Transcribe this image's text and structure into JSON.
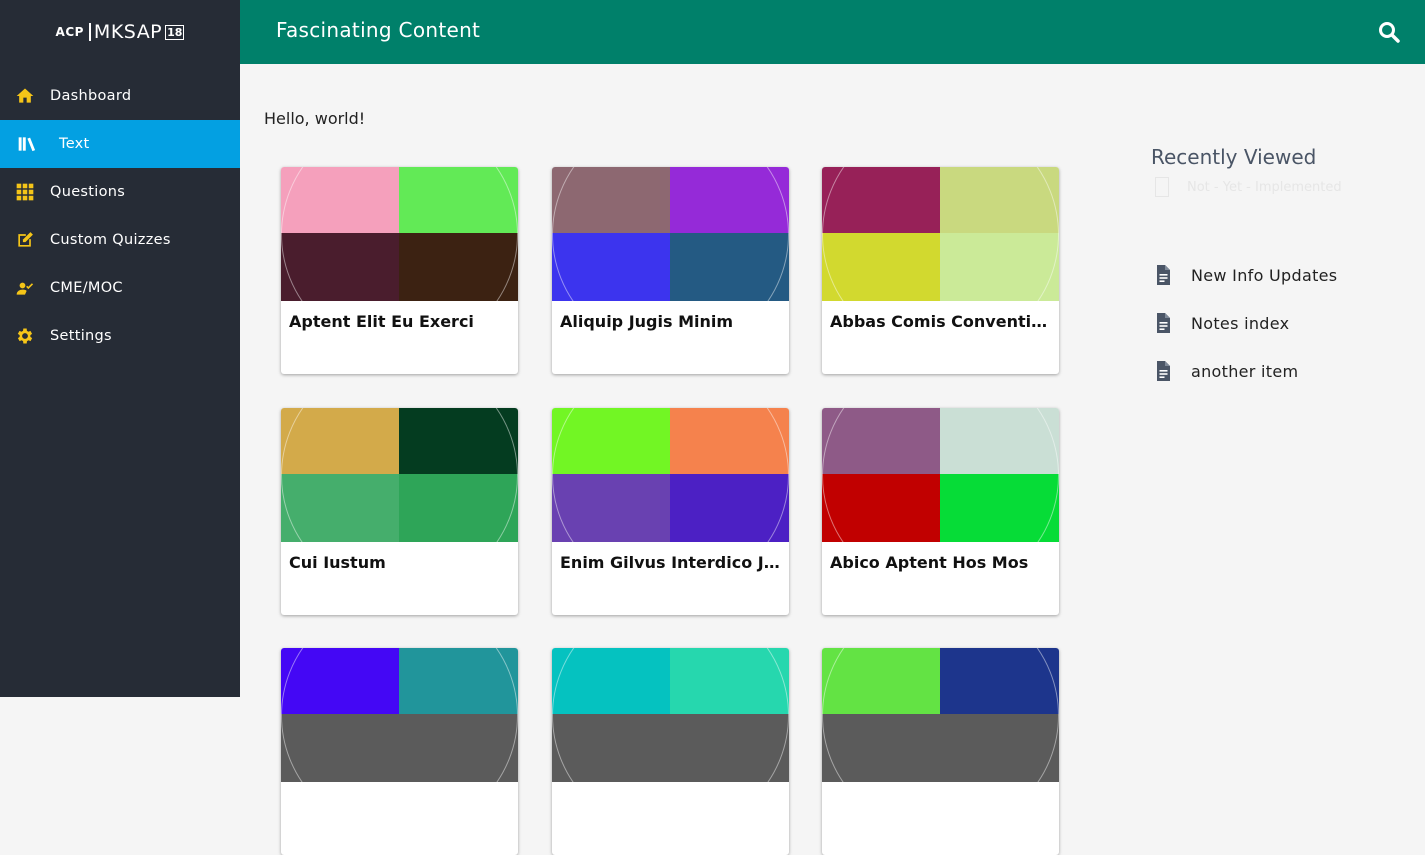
{
  "sidebar": {
    "logo": {
      "acp": "ACP",
      "product": "MKSAP",
      "edition": "18"
    },
    "items": [
      {
        "label": "Dashboard",
        "icon": "home-icon",
        "active": false
      },
      {
        "label": "Text",
        "icon": "books-icon",
        "active": true
      },
      {
        "label": "Questions",
        "icon": "grid-icon",
        "active": false
      },
      {
        "label": "Custom Quizzes",
        "icon": "edit-icon",
        "active": false
      },
      {
        "label": "CME/MOC",
        "icon": "person-check-icon",
        "active": false
      },
      {
        "label": "Settings",
        "icon": "gear-icon",
        "active": false
      }
    ]
  },
  "header": {
    "title": "Fascinating Content"
  },
  "main": {
    "greeting": "Hello, world!",
    "cards": [
      {
        "title": "Aptent Elit Eu Exerci",
        "colors": [
          "#f5a0bc",
          "#62ea56",
          "#4a1d2d",
          "#3c2212"
        ]
      },
      {
        "title": "Aliquip Jugis Minim",
        "colors": [
          "#8d6871",
          "#952ad8",
          "#3c34ee",
          "#245a83"
        ]
      },
      {
        "title": "Abbas Comis Conventio Esse",
        "colors": [
          "#972158",
          "#c9d97f",
          "#d2d92f",
          "#cbea98"
        ]
      },
      {
        "title": "Cui Iustum",
        "colors": [
          "#d3aa4a",
          "#043c20",
          "#45ae6c",
          "#2ea558"
        ]
      },
      {
        "title": "Enim Gilvus Interdico Jugis",
        "colors": [
          "#72f624",
          "#f5824d",
          "#6941b1",
          "#4c20c4"
        ]
      },
      {
        "title": "Abico Aptent Hos Mos",
        "colors": [
          "#8e5a87",
          "#cadfd5",
          "#c10000",
          "#06dc37"
        ]
      },
      {
        "title": "",
        "colors": [
          "#4407f5",
          "#21959b",
          "#5b5b5b",
          "#5b5b5b"
        ]
      },
      {
        "title": "",
        "colors": [
          "#05c2c0",
          "#26d7ae",
          "#5b5b5b",
          "#5b5b5b"
        ]
      },
      {
        "title": "",
        "colors": [
          "#63e344",
          "#1d358c",
          "#5b5b5b",
          "#5b5b5b"
        ]
      }
    ]
  },
  "right_panel": {
    "recently_viewed_title": "Recently Viewed",
    "recently_viewed_note": "Not - Yet - Implemented",
    "links": [
      {
        "label": "New Info Updates",
        "icon": "document-icon"
      },
      {
        "label": "Notes index",
        "icon": "document-icon"
      },
      {
        "label": "another item",
        "icon": "document-icon"
      }
    ]
  },
  "colors": {
    "sidebar_bg": "#262c36",
    "active_item": "#03a0e2",
    "header_bg": "#00806a",
    "icon_yellow": "#f5c518"
  }
}
